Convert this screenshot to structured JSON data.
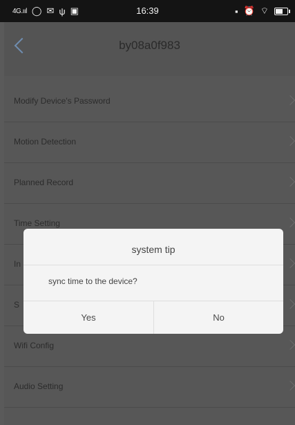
{
  "status_bar": {
    "network": "4G.ııl",
    "time": "16:39",
    "left_icons": [
      "circle-icon",
      "wechat-icon",
      "usb-icon",
      "image-icon"
    ],
    "right_icons": [
      "sim-icon",
      "alarm-icon",
      "wifi-icon",
      "battery-icon"
    ],
    "battery_level": 0.7
  },
  "nav": {
    "title": "by08a0f983"
  },
  "menu": {
    "items": [
      {
        "label": "Modify Device's Password"
      },
      {
        "label": "Motion Detection"
      },
      {
        "label": "Planned Record"
      },
      {
        "label": "Time Setting"
      },
      {
        "label": "In"
      },
      {
        "label": "S"
      },
      {
        "label": "Wifi Config"
      },
      {
        "label": "Audio Setting"
      }
    ]
  },
  "dialog": {
    "title": "system tip",
    "message": "sync time to the device?",
    "yes_label": "Yes",
    "no_label": "No"
  },
  "colors": {
    "overlay_bg": "#575757",
    "dialog_bg": "#f4f4f4",
    "back_arrow": "#6f8db0",
    "status_bar_bg": "#141414"
  }
}
